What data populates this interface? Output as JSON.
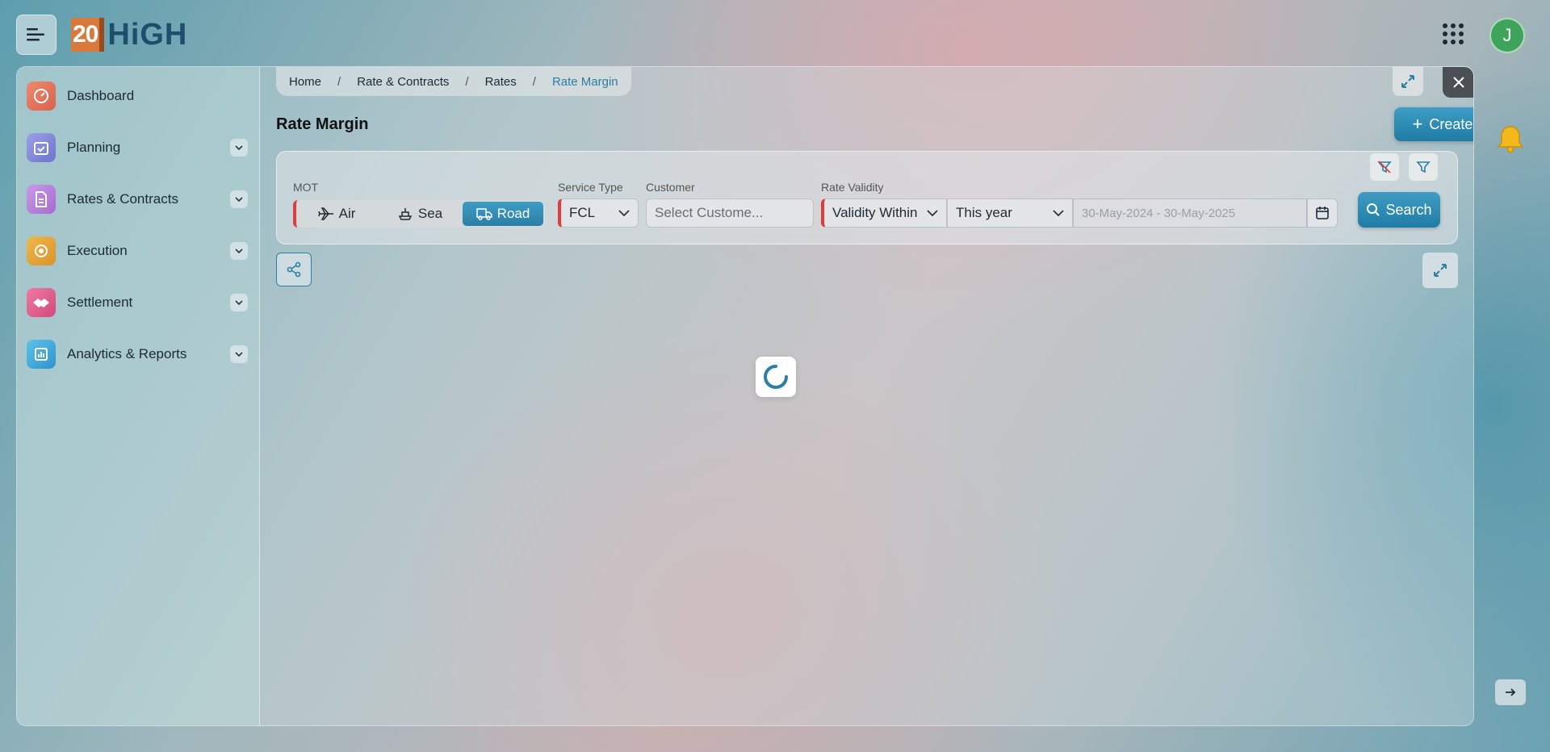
{
  "app": {
    "logo_number": "20",
    "logo_text": "HiGH",
    "user_initial": "J"
  },
  "sidebar": {
    "items": [
      {
        "label": "Dashboard",
        "icon": "gauge-icon",
        "color": "#e0795f",
        "expandable": false
      },
      {
        "label": "Planning",
        "icon": "calendar-check-icon",
        "color": "#7d86d6",
        "expandable": true
      },
      {
        "label": "Rates & Contracts",
        "icon": "document-icon",
        "color": "#b57fd6",
        "expandable": true
      },
      {
        "label": "Execution",
        "icon": "gear-cycle-icon",
        "color": "#e0a23a",
        "expandable": true
      },
      {
        "label": "Settlement",
        "icon": "handshake-icon",
        "color": "#e05a8a",
        "expandable": true
      },
      {
        "label": "Analytics & Reports",
        "icon": "report-icon",
        "color": "#3da6d9",
        "expandable": true
      }
    ]
  },
  "breadcrumb": {
    "items": [
      "Home",
      "Rate & Contracts",
      "Rates",
      "Rate Margin"
    ],
    "separator": "/"
  },
  "page": {
    "title": "Rate Margin",
    "create_label": "Create Margin"
  },
  "filters": {
    "mot_label": "MOT",
    "mot_options": [
      "Air",
      "Sea",
      "Road"
    ],
    "mot_selected": "Road",
    "service_type_label": "Service Type",
    "service_type_value": "FCL",
    "customer_label": "Customer",
    "customer_placeholder": "Select Custome...",
    "rate_validity_label": "Rate Validity",
    "validity_value": "Validity Within",
    "period_value": "This year",
    "date_range_placeholder": "30-May-2024 - 30-May-2025",
    "search_label": "Search"
  },
  "colors": {
    "accent": "#2a7fa3",
    "required": "#e23b3b",
    "avatar": "#3ea45b",
    "bell": "#f2b81c"
  }
}
